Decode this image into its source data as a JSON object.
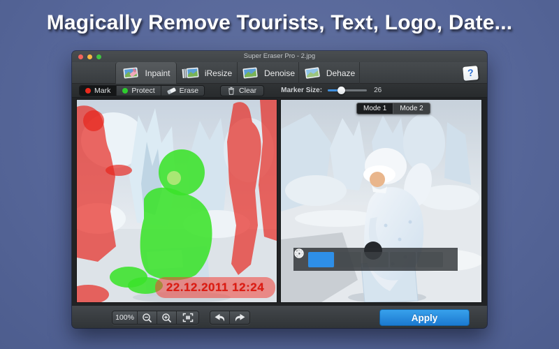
{
  "headline": "Magically Remove Tourists, Text, Logo, Date...",
  "window": {
    "title": "Super Eraser Pro - 2.jpg",
    "tabs": [
      {
        "label": "Inpaint",
        "active": true
      },
      {
        "label": "iResize",
        "active": false
      },
      {
        "label": "Denoise",
        "active": false
      },
      {
        "label": "Dehaze",
        "active": false
      }
    ],
    "help_label": "?"
  },
  "marker_toolbar": {
    "mark": "Mark",
    "protect": "Protect",
    "erase": "Erase",
    "clear": "Clear",
    "marker_size_label": "Marker Size:",
    "marker_size_value": "26"
  },
  "left_panel": {
    "date_stamp": "22.12.2011 12:24"
  },
  "right_panel": {
    "mode1": "Mode 1",
    "mode2": "Mode 2"
  },
  "bottom_toolbar": {
    "zoom_level": "100%",
    "apply": "Apply"
  },
  "colors": {
    "background": "#57679a",
    "accent_blue": "#2e8fe8",
    "apply_blue": "#1b79d0",
    "mark_red": "#ea2a1d",
    "protect_green": "#2ecc2e",
    "date_red": "#dd1a10"
  }
}
